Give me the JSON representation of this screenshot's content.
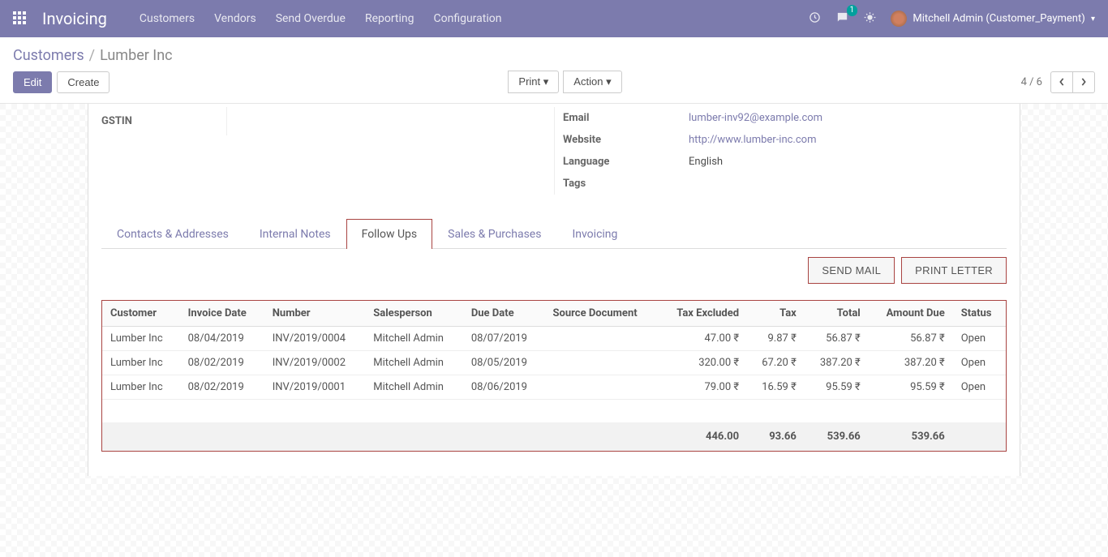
{
  "topbar": {
    "brand": "Invoicing",
    "menu": [
      "Customers",
      "Vendors",
      "Send Overdue",
      "Reporting",
      "Configuration"
    ],
    "chat_badge": "1",
    "user": "Mitchell Admin (Customer_Payment)"
  },
  "breadcrumb": {
    "parent": "Customers",
    "current": "Lumber Inc"
  },
  "control": {
    "edit": "Edit",
    "create": "Create",
    "print": "Print",
    "action": "Action",
    "pager": "4 / 6"
  },
  "record": {
    "gstin_label": "GSTIN",
    "email_label": "Email",
    "email": "lumber-inv92@example.com",
    "website_label": "Website",
    "website": "http://www.lumber-inc.com",
    "language_label": "Language",
    "language": "English",
    "tags_label": "Tags"
  },
  "tabs": [
    "Contacts & Addresses",
    "Internal Notes",
    "Follow Ups",
    "Sales & Purchases",
    "Invoicing"
  ],
  "actions": {
    "send_mail": "SEND MAIL",
    "print_letter": "PRINT LETTER"
  },
  "table": {
    "headers": {
      "customer": "Customer",
      "invoice_date": "Invoice Date",
      "number": "Number",
      "salesperson": "Salesperson",
      "due_date": "Due Date",
      "source_document": "Source Document",
      "tax_excluded": "Tax Excluded",
      "tax": "Tax",
      "total": "Total",
      "amount_due": "Amount Due",
      "status": "Status"
    },
    "rows": [
      {
        "customer": "Lumber Inc",
        "invoice_date": "08/04/2019",
        "number": "INV/2019/0004",
        "salesperson": "Mitchell Admin",
        "due_date": "08/07/2019",
        "source_document": "",
        "tax_excluded": "47.00 ₹",
        "tax": "9.87 ₹",
        "total": "56.87 ₹",
        "amount_due": "56.87 ₹",
        "status": "Open"
      },
      {
        "customer": "Lumber Inc",
        "invoice_date": "08/02/2019",
        "number": "INV/2019/0002",
        "salesperson": "Mitchell Admin",
        "due_date": "08/05/2019",
        "source_document": "",
        "tax_excluded": "320.00 ₹",
        "tax": "67.20 ₹",
        "total": "387.20 ₹",
        "amount_due": "387.20 ₹",
        "status": "Open"
      },
      {
        "customer": "Lumber Inc",
        "invoice_date": "08/02/2019",
        "number": "INV/2019/0001",
        "salesperson": "Mitchell Admin",
        "due_date": "08/06/2019",
        "source_document": "",
        "tax_excluded": "79.00 ₹",
        "tax": "16.59 ₹",
        "total": "95.59 ₹",
        "amount_due": "95.59 ₹",
        "status": "Open"
      }
    ],
    "totals": {
      "tax_excluded": "446.00",
      "tax": "93.66",
      "total": "539.66",
      "amount_due": "539.66"
    }
  }
}
